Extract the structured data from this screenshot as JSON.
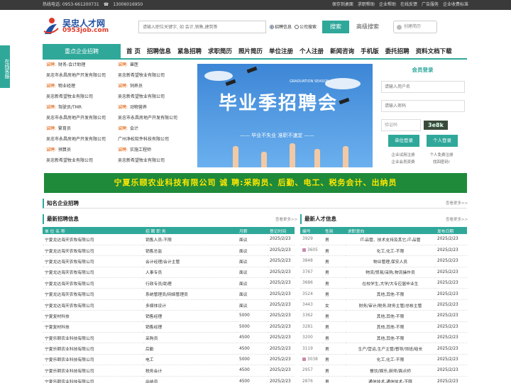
{
  "topbar": {
    "hotline": "热线电话: 0953-661200731",
    "mobile": "13006016950",
    "links": [
      "保存到桌面",
      "求职帮助",
      "企业帮助",
      "在线反馈",
      "广告服务",
      "企业收费标准"
    ]
  },
  "logo": {
    "title": "吴忠人才网",
    "domain": "0953job.com"
  },
  "search": {
    "placeholder": "请输入职位关键字, 如 会计,销售,建筑等",
    "option_job": "招聘信息",
    "option_company": "公司搜索",
    "button": "搜索",
    "advanced": "高级搜索",
    "resume": "创建简历"
  },
  "kefu": "在线客服",
  "nav": {
    "category": "重点企业招聘",
    "items": [
      "首 页",
      "招聘信息",
      "紧急招聘",
      "求职简历",
      "照片简历",
      "单位注册",
      "个人注册",
      "新闻咨询",
      "手机版",
      "委托招聘",
      "资料文档下载"
    ]
  },
  "featured": {
    "prefix": "诚聘:",
    "left": [
      {
        "job": "财务-会计助理",
        "company": "吴忠市永昌房地产开发有限公司"
      },
      {
        "job": "物业经理",
        "company": "吴忠新希望牧业有限公司"
      },
      {
        "job": "驾驶员/TMR",
        "company": "吴忠市永昌房地产开发有限公司"
      },
      {
        "job": "繁育员",
        "company": "吴忠市永昌房地产开发有限公司"
      },
      {
        "job": "预算员",
        "company": "吴忠新希望牧业有限公司"
      }
    ],
    "right": [
      {
        "job": "兽医",
        "company": "吴忠新希望牧业有限公司"
      },
      {
        "job": "饲养员",
        "company": "吴忠新希望牧业有限公司"
      },
      {
        "job": "动物营养",
        "company": "吴忠市永昌房地产开发有限公司"
      },
      {
        "job": "会计",
        "company": "广州净松软件科技有限公司"
      },
      {
        "job": "实施工程师",
        "company": "吴忠新希望牧业有限公司"
      }
    ]
  },
  "banner": {
    "title": "毕业季招聘会",
    "slogan": "—— 毕业不失业 准职不速定 ——",
    "en": "GRADUATION SEASON"
  },
  "login": {
    "title": "会员登录",
    "user_placeholder": "请输入用户名",
    "pass_placeholder": "请输入密码",
    "code_label": "验证码",
    "code": "3e8k",
    "company_btn": "单位登录",
    "person_btn": "个人登录",
    "company_note1": "企业试用注册",
    "company_note2": "企业会员资费",
    "person_note1": "个人免费注册",
    "person_note2": "找回密码!"
  },
  "ad_banner": "宁夏乐颐农业科技有限公司 诚 聘:采购员、后勤、电工、税务会计、出纳员",
  "sections": {
    "famous": "知名企业招聘",
    "famous_more": "查看更多>>",
    "jobs_title": "最新招聘信息",
    "jobs_more": "查看更多>>",
    "talent_title": "最新人才信息",
    "talent_more": "查看更多>>"
  },
  "jobs_table": {
    "headers": [
      "单 位 名 称",
      "招 聘 职 务",
      "月薪",
      "登记时间"
    ],
    "rows": [
      [
        "宁夏龙达海天农牧有限公司",
        "销售人员-不限",
        "面议",
        "2025/2/23"
      ],
      [
        "宁夏龙达海天农牧有限公司",
        "销售总监",
        "面议",
        "2025/2/23"
      ],
      [
        "宁夏龙达海天农牧有限公司",
        "会计经理/会计主管",
        "面议",
        "2025/2/23"
      ],
      [
        "宁夏龙达海天农牧有限公司",
        "人事专员",
        "面议",
        "2025/2/23"
      ],
      [
        "宁夏龙达海天农牧有限公司",
        "行政专员/助理",
        "面议",
        "2025/2/23"
      ],
      [
        "宁夏龙达海天农牧有限公司",
        "系统管理员/网络管理员",
        "面议",
        "2025/2/23"
      ],
      [
        "宁夏龙达海天农牧有限公司",
        "多媒体设计",
        "面议",
        "2025/2/23"
      ],
      [
        "宁夏复材科技",
        "销售经理",
        "5000",
        "2025/2/23"
      ],
      [
        "宁夏复材科技",
        "销售经理",
        "5000",
        "2025/2/23"
      ],
      [
        "宁夏乐颐农业科技有限公司",
        "采购员",
        "4500",
        "2025/2/23"
      ],
      [
        "宁夏乐颐农业科技有限公司",
        "后勤",
        "4500",
        "2025/2/23"
      ],
      [
        "宁夏乐颐农业科技有限公司",
        "电工",
        "5000",
        "2025/2/23"
      ],
      [
        "宁夏乐颐农业科技有限公司",
        "税务会计",
        "4500",
        "2025/2/23"
      ],
      [
        "宁夏乐颐农业科技有限公司",
        "出纳员",
        "4500",
        "2025/2/23"
      ]
    ]
  },
  "talent_table": {
    "headers": [
      "编号",
      "性别",
      "求职意向",
      "发布日期"
    ],
    "rows": [
      [
        "3929",
        "男",
        "IT-品管、技术支持及其它,IT-品管",
        "2025/2/23"
      ],
      [
        "3605",
        "男",
        "化工,化工-不限",
        "2025/2/23"
      ],
      [
        "3848",
        "男",
        "物业管理,保安人员",
        "2025/2/23"
      ],
      [
        "3767",
        "男",
        "物流/贸易/采购,物流操作员",
        "2025/2/23"
      ],
      [
        "3686",
        "男",
        "在校学生,大学/大专应届毕业生",
        "2025/2/23"
      ],
      [
        "3524",
        "男",
        "其他,其他-不限",
        "2025/2/23"
      ],
      [
        "3443",
        "女",
        "财务/审计/税务,财务主管/总帐主管",
        "2025/2/23"
      ],
      [
        "3362",
        "男",
        "其他,其他-不限",
        "2025/2/23"
      ],
      [
        "3281",
        "男",
        "其他,其他-不限",
        "2025/2/23"
      ],
      [
        "3200",
        "男",
        "其他,其他-不限",
        "2025/2/23"
      ],
      [
        "3119",
        "男",
        "生产/营运,生产主管/督导/领班/组长",
        "2025/2/23"
      ],
      [
        "3038",
        "男",
        "化工,化工-不限",
        "2025/2/23"
      ],
      [
        "2957",
        "男",
        "餐饮/娱乐,厨师/面点师",
        "2025/2/23"
      ],
      [
        "2876",
        "男",
        "通信技术,通信技术-不限",
        "2025/2/23"
      ]
    ],
    "photo_ids": [
      "3605",
      "3038"
    ]
  }
}
